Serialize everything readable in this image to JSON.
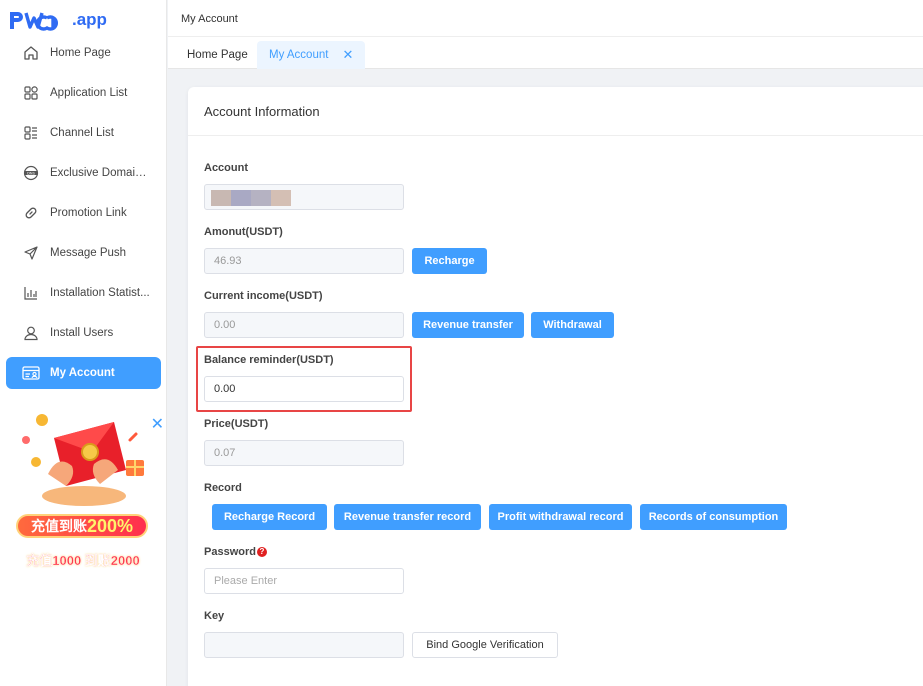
{
  "brand": {
    "name": "PWA",
    "suffix": ".app"
  },
  "sidebar": {
    "items": [
      {
        "label": "Home Page",
        "icon": "home-icon"
      },
      {
        "label": "Application List",
        "icon": "grid-icon"
      },
      {
        "label": "Channel List",
        "icon": "list-icon"
      },
      {
        "label": "Exclusive Domain...",
        "icon": "dns-globe-icon"
      },
      {
        "label": "Promotion Link",
        "icon": "link-icon"
      },
      {
        "label": "Message Push",
        "icon": "send-icon"
      },
      {
        "label": "Installation Statist...",
        "icon": "bar-chart-icon"
      },
      {
        "label": "Install Users",
        "icon": "user-icon"
      },
      {
        "label": "My Account",
        "icon": "account-card-icon",
        "active": true
      }
    ],
    "ad": {
      "line1_prefix": "充值到账",
      "line1_big": "200%",
      "line2": "充值1000 到账2000",
      "close": "✕"
    }
  },
  "header": {
    "title": "My Account"
  },
  "tabs": [
    {
      "label": "Home Page"
    },
    {
      "label": "My Account",
      "active": true,
      "close": "✕"
    }
  ],
  "card": {
    "title": "Account Information",
    "account_label": "Account",
    "amount_label": "Amonut(USDT)",
    "amount_value": "46.93",
    "recharge_button": "Recharge",
    "income_label": "Current income(USDT)",
    "income_value": "0.00",
    "revenue_transfer_button": "Revenue transfer",
    "withdrawal_button": "Withdrawal",
    "balance_label": "Balance reminder(USDT)",
    "balance_value": "0.00",
    "price_label": "Price(USDT)",
    "price_value": "0.07",
    "record_label": "Record",
    "record_buttons": [
      "Recharge Record",
      "Revenue transfer record",
      "Profit withdrawal record",
      "Records of consumption"
    ],
    "password_label": "Password",
    "password_hint_icon": "?",
    "password_placeholder": "Please Enter",
    "key_label": "Key",
    "bind_google_button": "Bind Google Verification"
  },
  "colors": {
    "accent": "#409eff",
    "highlight": "#e84545",
    "brand": "#2f6bf3"
  }
}
